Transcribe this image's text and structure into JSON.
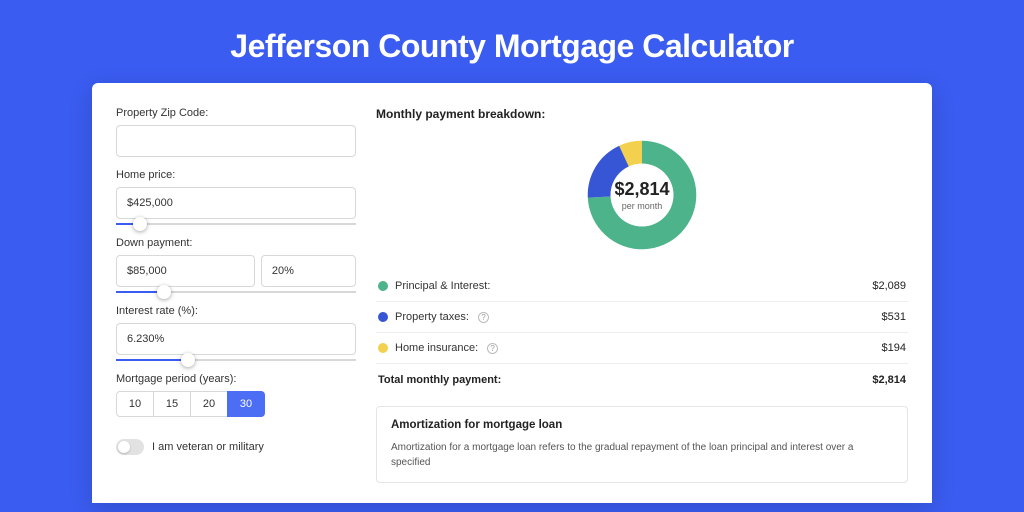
{
  "page_title": "Jefferson County Mortgage Calculator",
  "form": {
    "zip_label": "Property Zip Code:",
    "zip_value": "",
    "home_price_label": "Home price:",
    "home_price_value": "$425,000",
    "home_price_slider_pct": 10,
    "down_payment_label": "Down payment:",
    "down_payment_value": "$85,000",
    "down_payment_pct_value": "20%",
    "down_payment_slider_pct": 20,
    "interest_label": "Interest rate (%):",
    "interest_value": "6.230%",
    "interest_slider_pct": 30,
    "period_label": "Mortgage period (years):",
    "periods": [
      "10",
      "15",
      "20",
      "30"
    ],
    "period_active_index": 3,
    "veteran_label": "I am veteran or military",
    "veteran_on": false
  },
  "breakdown": {
    "title": "Monthly payment breakdown:",
    "total_amount": "$2,814",
    "total_sub": "per month",
    "items": [
      {
        "label": "Principal & Interest:",
        "value": "$2,089",
        "color": "#4cb38b",
        "help": false
      },
      {
        "label": "Property taxes:",
        "value": "$531",
        "color": "#3756d6",
        "help": true
      },
      {
        "label": "Home insurance:",
        "value": "$194",
        "color": "#f3d04e",
        "help": true
      }
    ],
    "total_label": "Total monthly payment:",
    "total_value": "$2,814"
  },
  "chart_data": {
    "type": "pie",
    "title": "Monthly payment breakdown",
    "series": [
      {
        "name": "Principal & Interest",
        "value": 2089,
        "color": "#4cb38b"
      },
      {
        "name": "Property taxes",
        "value": 531,
        "color": "#3756d6"
      },
      {
        "name": "Home insurance",
        "value": 194,
        "color": "#f3d04e"
      }
    ],
    "center_label": "$2,814",
    "center_sub": "per month"
  },
  "amortization": {
    "title": "Amortization for mortgage loan",
    "text": "Amortization for a mortgage loan refers to the gradual repayment of the loan principal and interest over a specified"
  }
}
